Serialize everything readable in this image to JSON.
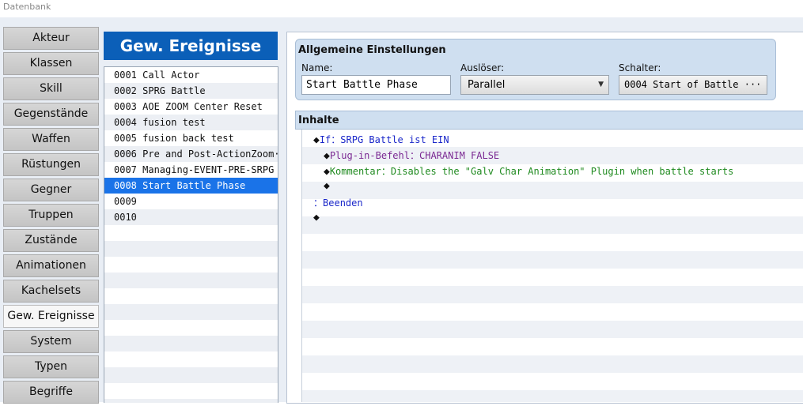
{
  "window": {
    "title": "Datenbank"
  },
  "tabs": [
    "Akteur",
    "Klassen",
    "Skill",
    "Gegenstände",
    "Waffen",
    "Rüstungen",
    "Gegner",
    "Truppen",
    "Zustände",
    "Animationen",
    "Kachelsets",
    "Gew. Ereignisse",
    "System",
    "Typen",
    "Begriffe"
  ],
  "active_tab": "Gew. Ereignisse",
  "event_list": {
    "title": "Gew. Ereignisse",
    "items": [
      "0001 Call Actor",
      "0002 SPRG Battle",
      "0003 AOE ZOOM Center Reset",
      "0004 fusion test",
      "0005 fusion back test",
      "0006 Pre and Post-ActionZoom···",
      "0007 Managing-EVENT-PRE-SRPG",
      "0008 Start Battle Phase",
      "0009",
      "0010"
    ],
    "selected": "0008 Start Battle Phase"
  },
  "general": {
    "title": "Allgemeine Einstellungen",
    "name_label": "Name:",
    "name_value": "Start Battle Phase",
    "trigger_label": "Auslöser:",
    "trigger_value": "Parallel",
    "switch_label": "Schalter:",
    "switch_value": "0004 Start of Battle ··· ···"
  },
  "contents": {
    "title": "Inhalte",
    "if_keyword": "If",
    "if_condition": "SRPG Battle ist EIN",
    "plugin_keyword": "Plug-in-Befehl",
    "plugin_value": "CHARANIM FALSE",
    "comment_keyword": "Kommentar",
    "comment_value": "Disables the \"Galv Char Animation\" Plugin when battle starts",
    "end_label": "Beenden",
    "bullet": "◆",
    "separator": "："
  },
  "colors": {
    "selection": "#1a73e8",
    "list_title_bg": "#0b5fb8",
    "panel_bg": "#cfdff0",
    "command_blue": "#1a27c9",
    "command_purple": "#7b2a93",
    "command_green": "#1f8a1f"
  }
}
